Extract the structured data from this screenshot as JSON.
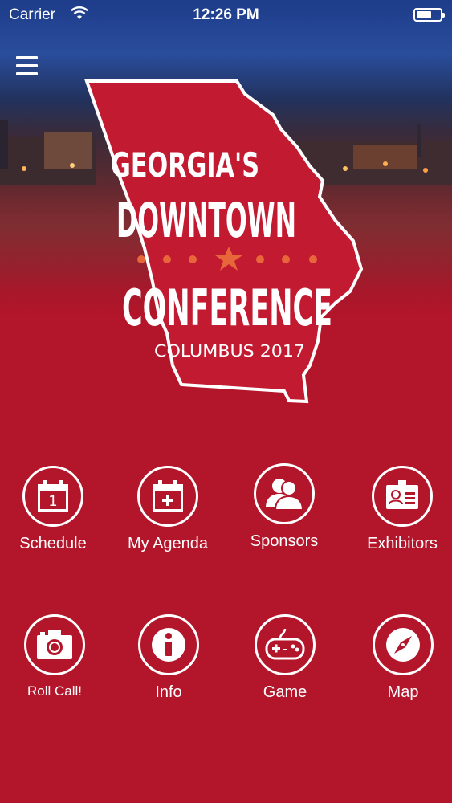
{
  "status_bar": {
    "carrier": "Carrier",
    "time": "12:26 PM"
  },
  "menu": {
    "icon": "hamburger-menu-icon"
  },
  "logo": {
    "line1": "GEORGIA'S",
    "line2": "DOWNTOWN",
    "line3": "CONFERENCE",
    "subtitle": "COLUMBUS 2017"
  },
  "colors": {
    "brand_red": "#b3152a",
    "accent_orange": "#e8673a",
    "white": "#ffffff"
  },
  "tiles": [
    {
      "label": "Schedule",
      "icon": "calendar-icon",
      "calendar_day": "1"
    },
    {
      "label": "My Agenda",
      "icon": "calendar-add-icon"
    },
    {
      "label": "Sponsors",
      "icon": "people-icon"
    },
    {
      "label": "Exhibitors",
      "icon": "id-badge-icon"
    },
    {
      "label": "Roll Call!",
      "icon": "camera-icon"
    },
    {
      "label": "Info",
      "icon": "info-icon"
    },
    {
      "label": "Game",
      "icon": "gamepad-icon"
    },
    {
      "label": "Map",
      "icon": "compass-icon"
    }
  ]
}
